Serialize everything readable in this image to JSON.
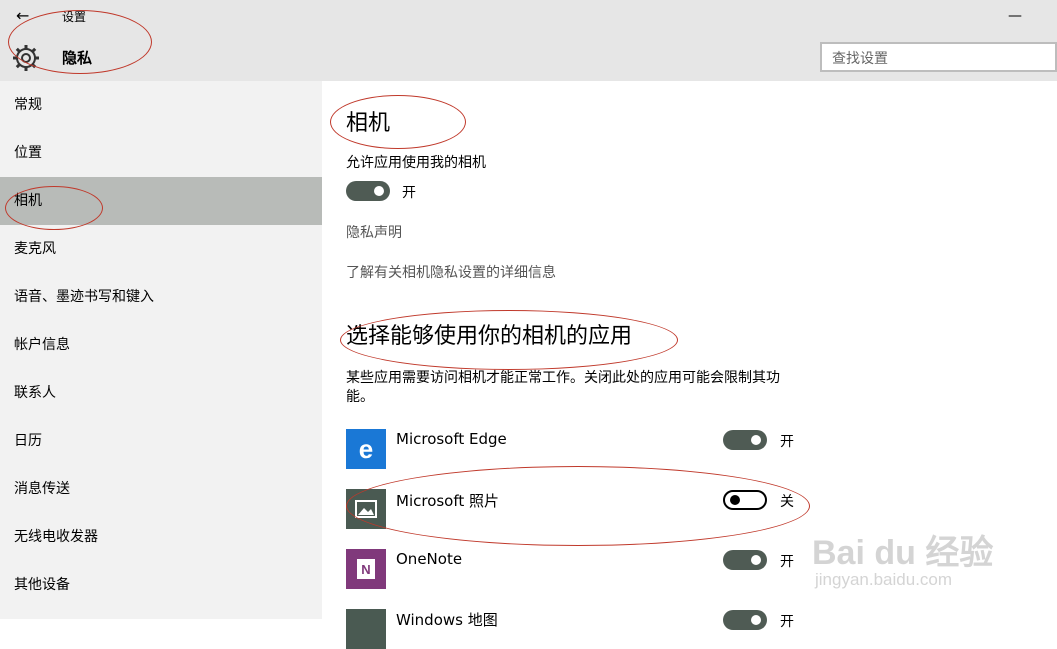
{
  "window": {
    "title": "设置",
    "back_glyph": "←",
    "minimize_glyph": "—"
  },
  "header": {
    "page_title": "隐私",
    "search_placeholder": "查找设置"
  },
  "sidebar": {
    "items": [
      {
        "label": "常规"
      },
      {
        "label": "位置"
      },
      {
        "label": "相机",
        "active": true
      },
      {
        "label": "麦克风"
      },
      {
        "label": "语音、墨迹书写和键入"
      },
      {
        "label": "帐户信息"
      },
      {
        "label": "联系人"
      },
      {
        "label": "日历"
      },
      {
        "label": "消息传送"
      },
      {
        "label": "无线电收发器"
      },
      {
        "label": "其他设备"
      }
    ]
  },
  "main": {
    "title": "相机",
    "allow_label": "允许应用使用我的相机",
    "allow_state": "开",
    "privacy_statement": "隐私声明",
    "learn_more": "了解有关相机隐私设置的详细信息",
    "apps_title": "选择能够使用你的相机的应用",
    "apps_desc": "某些应用需要访问相机才能正常工作。关闭此处的应用可能会限制其功能。",
    "apps": [
      {
        "name": "Microsoft Edge",
        "state": "开",
        "on": true,
        "icon": "edge-icon",
        "color": "#1a78d6"
      },
      {
        "name": "Microsoft 照片",
        "state": "关",
        "on": false,
        "icon": "photos-icon",
        "color": "#4a5a52"
      },
      {
        "name": "OneNote",
        "state": "开",
        "on": true,
        "icon": "onenote-icon",
        "color": "#80397b"
      },
      {
        "name": "Windows 地图",
        "state": "开",
        "on": true,
        "icon": "maps-icon",
        "color": "#4a5a52"
      }
    ]
  },
  "watermark": {
    "brand": "Bai du 经验",
    "url": "jingyan.baidu.com"
  }
}
